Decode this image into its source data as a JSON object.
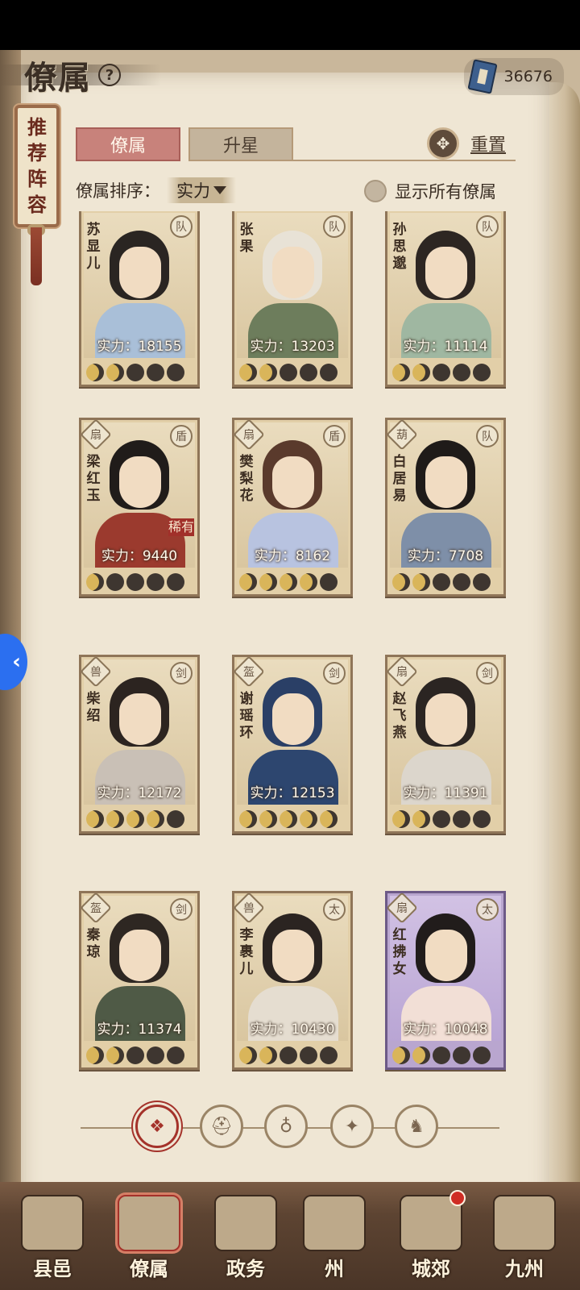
{
  "header": {
    "title": "僚属",
    "help_icon": "?"
  },
  "currency": {
    "icon": "book-icon",
    "value": "36676"
  },
  "scroll_banner": {
    "text": "推荐阵容"
  },
  "tabs": [
    {
      "label": "僚属",
      "active": true
    },
    {
      "label": "升星",
      "active": false
    }
  ],
  "reset": {
    "label": "重置",
    "icon": "reset-icon"
  },
  "sort": {
    "label": "僚属排序：",
    "value": "实力"
  },
  "show_all": {
    "label": "显示所有僚属",
    "checked": false
  },
  "cards": [
    {
      "name": "苏显儿",
      "power": "实力：18155",
      "stars": 2,
      "badge_right": "队",
      "badge_left": "",
      "rare": "",
      "purple": false,
      "hair": "#2a2522",
      "robe": "#a9bfd8"
    },
    {
      "name": "张果",
      "power": "实力：13203",
      "stars": 2,
      "badge_right": "队",
      "badge_left": "",
      "rare": "",
      "purple": false,
      "hair": "#e8e2d6",
      "robe": "#6d7d5c"
    },
    {
      "name": "孙思邈",
      "power": "实力：11114",
      "stars": 2,
      "badge_right": "队",
      "badge_left": "",
      "rare": "",
      "purple": false,
      "hair": "#2d2622",
      "robe": "#9fb7a1"
    },
    {
      "name": "梁红玉",
      "power": "实力：9440",
      "stars": 1,
      "badge_right": "盾",
      "badge_left": "扇",
      "rare": "稀有",
      "purple": false,
      "hair": "#201c1a",
      "robe": "#9b3a2e"
    },
    {
      "name": "樊梨花",
      "power": "实力：8162",
      "stars": 4,
      "badge_right": "盾",
      "badge_left": "扇",
      "rare": "",
      "purple": false,
      "hair": "#5a3a2c",
      "robe": "#b8c3e0"
    },
    {
      "name": "白居易",
      "power": "实力：7708",
      "stars": 2,
      "badge_right": "队",
      "badge_left": "葫",
      "rare": "",
      "purple": false,
      "hair": "#1f1b19",
      "robe": "#7e8fa8"
    },
    {
      "name": "柴绍",
      "power": "实力：12172",
      "stars": 4,
      "badge_right": "剑",
      "badge_left": "兽",
      "rare": "",
      "purple": false,
      "hair": "#2c2420",
      "robe": "#c9c0b6"
    },
    {
      "name": "谢瑶环",
      "power": "实力：12153",
      "stars": 5,
      "badge_right": "剑",
      "badge_left": "盔",
      "rare": "",
      "purple": false,
      "hair": "#2a3f66",
      "robe": "#2d466f"
    },
    {
      "name": "赵飞燕",
      "power": "实力：11391",
      "stars": 2,
      "badge_right": "剑",
      "badge_left": "扇",
      "rare": "",
      "purple": false,
      "hair": "#2b2522",
      "robe": "#dcd6cc"
    },
    {
      "name": "秦琼",
      "power": "实力：11374",
      "stars": 2,
      "badge_right": "剑",
      "badge_left": "盔",
      "rare": "",
      "purple": false,
      "hair": "#2e2722",
      "robe": "#4f5a46"
    },
    {
      "name": "李裹儿",
      "power": "实力：10430",
      "stars": 2,
      "badge_right": "太",
      "badge_left": "兽",
      "rare": "",
      "purple": false,
      "hair": "#2b2421",
      "robe": "#e5ddd0"
    },
    {
      "name": "红拂女",
      "power": "实力：10048",
      "stars": 2,
      "badge_right": "太",
      "badge_left": "扇",
      "rare": "",
      "purple": true,
      "hair": "#211c1b",
      "robe": "#f2dfd6"
    }
  ],
  "filters": [
    {
      "icon": "all-filter-icon",
      "glyph": "❖",
      "active": true
    },
    {
      "icon": "helmet-filter-icon",
      "glyph": "⛑",
      "active": false
    },
    {
      "icon": "gourd-filter-icon",
      "glyph": "♁",
      "active": false
    },
    {
      "icon": "fan-filter-icon",
      "glyph": "✦",
      "active": false
    },
    {
      "icon": "beast-filter-icon",
      "glyph": "♞",
      "active": false
    }
  ],
  "nav": [
    {
      "label": "县邑",
      "active": false,
      "dot": false
    },
    {
      "label": "僚属",
      "active": true,
      "dot": false
    },
    {
      "label": "政务",
      "active": false,
      "dot": false
    },
    {
      "label": "州",
      "active": false,
      "dot": false
    },
    {
      "label": "城郊",
      "active": false,
      "dot": true
    },
    {
      "label": "九州",
      "active": false,
      "dot": false
    }
  ],
  "side_tab": {
    "glyph": "‹"
  }
}
